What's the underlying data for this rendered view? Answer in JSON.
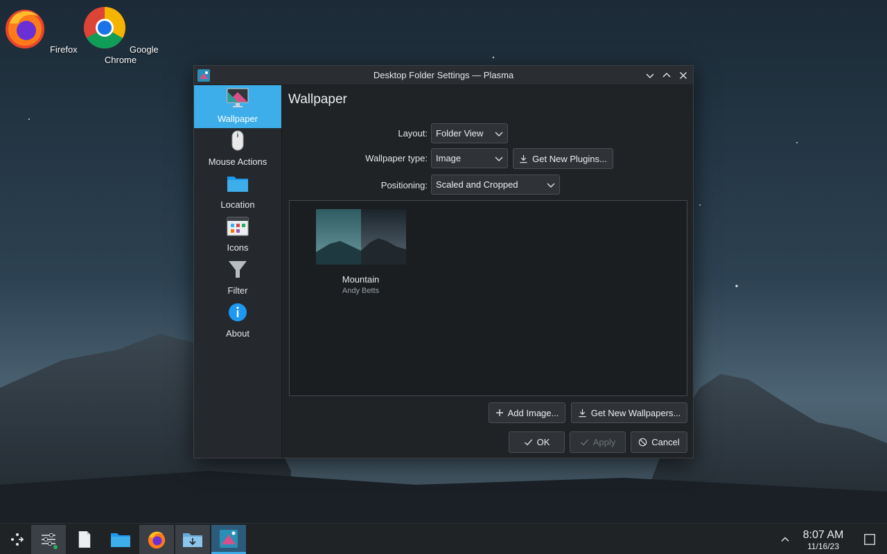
{
  "desktop": {
    "icons": [
      {
        "label": "Firefox"
      },
      {
        "label": "Google Chrome"
      }
    ]
  },
  "window": {
    "title": "Desktop Folder Settings — Plasma",
    "sidebar": {
      "items": [
        {
          "label": "Wallpaper",
          "icon": "monitor-icon",
          "active": true
        },
        {
          "label": "Mouse Actions",
          "icon": "mouse-icon"
        },
        {
          "label": "Location",
          "icon": "folder-icon"
        },
        {
          "label": "Icons",
          "icon": "icons-grid-icon"
        },
        {
          "label": "Filter",
          "icon": "filter-funnel-icon"
        },
        {
          "label": "About",
          "icon": "info-icon"
        }
      ]
    },
    "content": {
      "title": "Wallpaper",
      "layout_label": "Layout:",
      "layout_value": "Folder View",
      "wallpaper_type_label": "Wallpaper type:",
      "wallpaper_type_value": "Image",
      "get_new_plugins": "Get New Plugins...",
      "positioning_label": "Positioning:",
      "positioning_value": "Scaled and Cropped",
      "wallpapers": [
        {
          "name": "Mountain",
          "author": "Andy Betts"
        }
      ],
      "add_image": "Add Image...",
      "get_new_wallpapers": "Get New Wallpapers..."
    },
    "buttons": {
      "ok": "OK",
      "apply": "Apply",
      "cancel": "Cancel"
    }
  },
  "taskbar": {
    "time": "8:07 AM",
    "date": "11/16/23"
  },
  "colors": {
    "accent": "#3daee9",
    "window_bg": "#202326",
    "sidebar_bg": "#25292d"
  }
}
